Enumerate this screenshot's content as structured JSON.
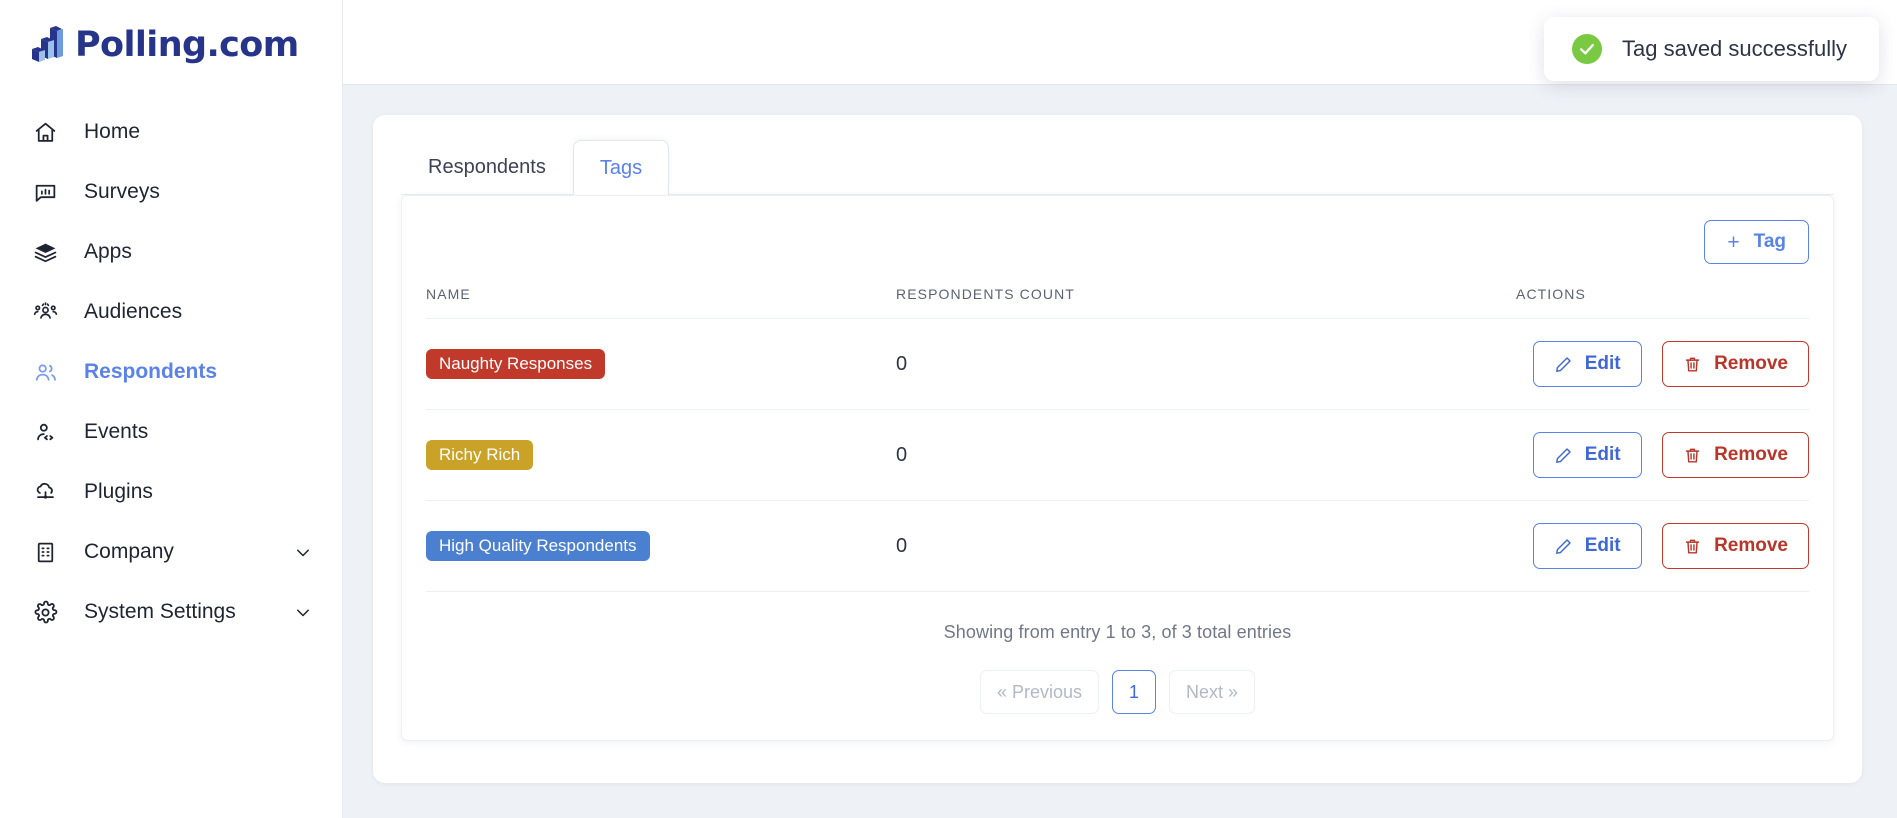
{
  "brand": {
    "name": "Polling.com",
    "logo_icon": "bar-chart-blocks-icon",
    "color": "#26348a"
  },
  "sidebar": {
    "items": [
      {
        "label": "Home",
        "icon": "home-icon",
        "active": false,
        "expandable": false
      },
      {
        "label": "Surveys",
        "icon": "survey-icon",
        "active": false,
        "expandable": false
      },
      {
        "label": "Apps",
        "icon": "layers-icon",
        "active": false,
        "expandable": false
      },
      {
        "label": "Audiences",
        "icon": "audiences-icon",
        "active": false,
        "expandable": false
      },
      {
        "label": "Respondents",
        "icon": "respondents-icon",
        "active": true,
        "expandable": false
      },
      {
        "label": "Events",
        "icon": "events-icon",
        "active": false,
        "expandable": false
      },
      {
        "label": "Plugins",
        "icon": "plugins-icon",
        "active": false,
        "expandable": false
      },
      {
        "label": "Company",
        "icon": "building-icon",
        "active": false,
        "expandable": true
      },
      {
        "label": "System Settings",
        "icon": "gear-icon",
        "active": false,
        "expandable": true
      }
    ],
    "chevron_icon": "chevron-down-icon",
    "active_color": "#5b82e8"
  },
  "toast": {
    "message": "Tag saved successfully",
    "icon": "check-circle-icon",
    "icon_color": "#7ac943"
  },
  "tabs": [
    {
      "label": "Respondents",
      "active": false
    },
    {
      "label": "Tags",
      "active": true
    }
  ],
  "toolbar": {
    "add_tag_label": "Tag",
    "add_tag_plus": "+",
    "add_tag_icon": "plus-icon"
  },
  "table": {
    "headers": {
      "name": "NAME",
      "count": "RESPONDENTS COUNT",
      "actions": "ACTIONS"
    },
    "rows": [
      {
        "tag": "Naughty Responses",
        "color": "#c0392b",
        "count": "0",
        "edit_label": "Edit",
        "remove_label": "Remove"
      },
      {
        "tag": "Richy Rich",
        "color": "#c9a227",
        "count": "0",
        "edit_label": "Edit",
        "remove_label": "Remove"
      },
      {
        "tag": "High Quality Respondents",
        "color": "#4b7fd0",
        "count": "0",
        "edit_label": "Edit",
        "remove_label": "Remove"
      }
    ],
    "edit_icon": "pencil-icon",
    "remove_icon": "trash-icon"
  },
  "footer": {
    "showing": "Showing from entry 1 to 3, of 3 total entries",
    "pagination": {
      "previous": "« Previous",
      "next": "Next »",
      "pages": [
        "1"
      ],
      "current_page": "1"
    }
  }
}
